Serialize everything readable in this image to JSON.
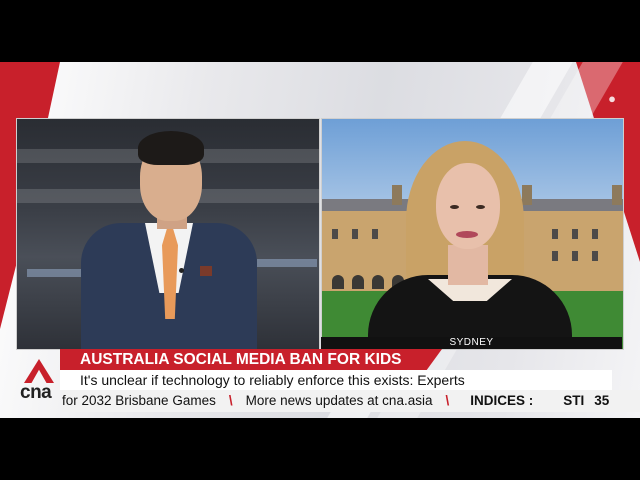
{
  "broadcast": {
    "location_label": "SYDNEY",
    "headline": "AUSTRALIA SOCIAL MEDIA BAN FOR KIDS",
    "subheadline": "It's unclear if technology to reliably enforce this exists: Experts",
    "logo_text": "cna",
    "watermark_icon": "cna-watermark-icon"
  },
  "ticker": {
    "item_1": "for 2032 Brisbane Games",
    "item_2": "More news updates at cna.asia",
    "indices_label": "INDICES :",
    "stock_label": "STI",
    "stock_value": "35"
  },
  "colors": {
    "brand_red": "#c8202b",
    "ticker_bg": "#f2f2f2"
  }
}
